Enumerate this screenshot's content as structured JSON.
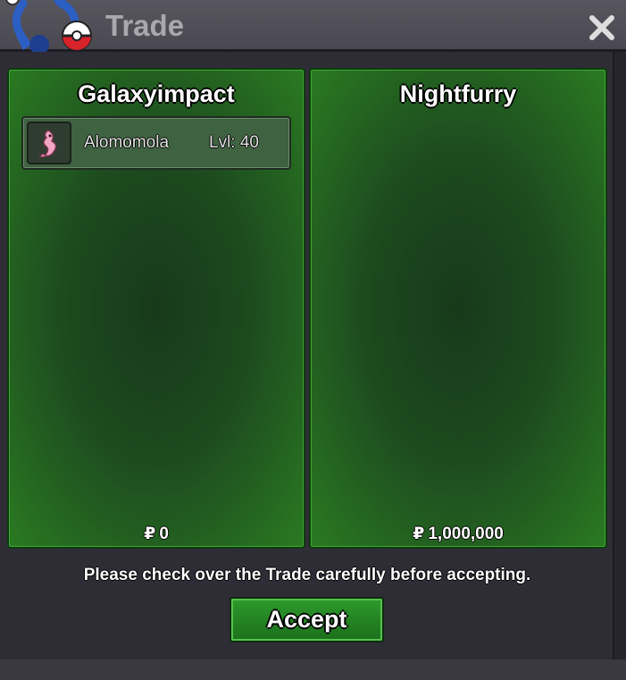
{
  "window": {
    "title": "Trade",
    "close_icon": "close-icon",
    "trade_icon": "trade-swap-icon"
  },
  "left_panel": {
    "player_name": "Galaxyimpact",
    "items": [
      {
        "icon": "pokemon-alomomola-icon",
        "name": "Alomomola",
        "level": "Lvl: 40"
      }
    ],
    "currency_symbol": "₽",
    "money": "0"
  },
  "right_panel": {
    "player_name": "Nightfurry",
    "items": [],
    "currency_symbol": "₽",
    "money": "1,000,000"
  },
  "notice": "Please check over the Trade carefully before accepting.",
  "accept_button": {
    "label": "Accept"
  },
  "colors": {
    "panel_green": "#2a7a22",
    "button_green": "#2e9a2b",
    "titlebar": "#4a4952"
  }
}
